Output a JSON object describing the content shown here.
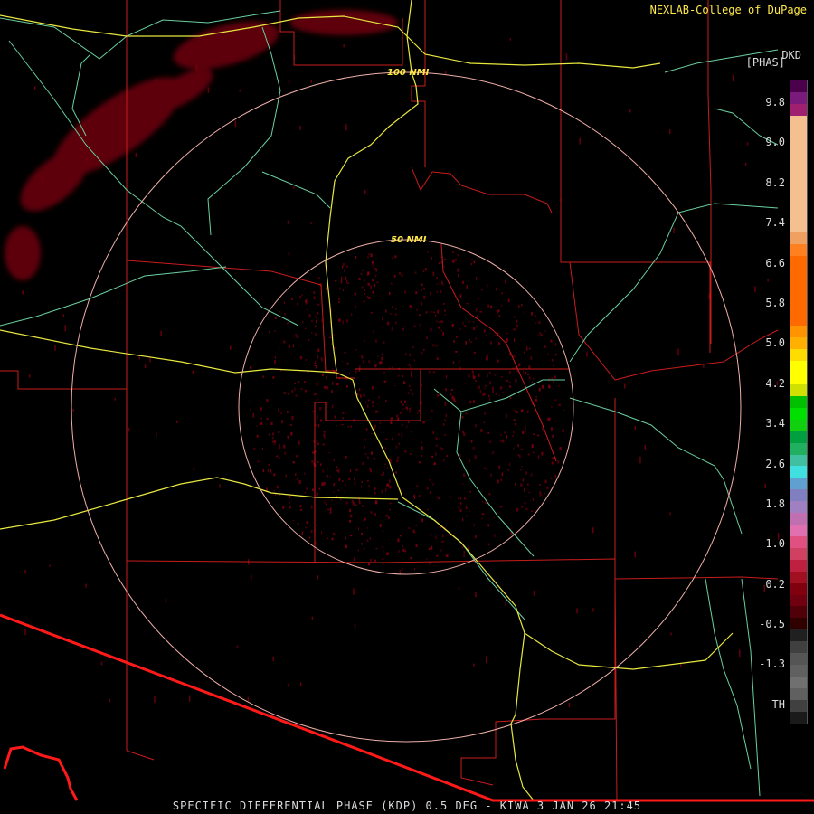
{
  "header": {
    "credit": "NEXLAB-College of DuPage",
    "product_code": "DKD",
    "units": "[PHAS]"
  },
  "footer": {
    "caption": "SPECIFIC DIFFERENTIAL PHASE (KDP) 0.5 DEG - KIWA 3 JAN 26 21:45"
  },
  "range_rings": [
    {
      "label": "50 NMI",
      "range_nmi": 50
    },
    {
      "label": "100 NMI",
      "range_nmi": 100
    }
  ],
  "colorbar": {
    "tick_labels": [
      "9.8",
      "9.0",
      "8.2",
      "7.4",
      "6.6",
      "5.8",
      "5.0",
      "4.2",
      "3.4",
      "2.6",
      "1.8",
      "1.0",
      "0.2",
      "-0.5",
      "-1.3",
      "TH"
    ],
    "colors": [
      "#4a004a",
      "#7a1a7a",
      "#a02070",
      "#f4c090",
      "#f4c090",
      "#f4c090",
      "#f4c090",
      "#f4c090",
      "#f4c090",
      "#f4c090",
      "#f4c090",
      "#f4c090",
      "#f4c090",
      "#f0a060",
      "#ff8020",
      "#ff6a00",
      "#ff6a00",
      "#ff6a00",
      "#ff6a00",
      "#ff6a00",
      "#ff6a00",
      "#ff9400",
      "#ffb000",
      "#ffdc00",
      "#ffff00",
      "#ffff00",
      "#d0e000",
      "#00c000",
      "#00e000",
      "#10d010",
      "#00a040",
      "#20b060",
      "#40c0a0",
      "#40e0e0",
      "#60a0d0",
      "#8080c0",
      "#a080c0",
      "#c070b0",
      "#e070b0",
      "#e05080",
      "#d04060",
      "#c02040",
      "#a01020",
      "#800010",
      "#700010",
      "#500008",
      "#300000",
      "#202020",
      "#404040",
      "#555555",
      "#606060",
      "#707070",
      "#606060",
      "#404040",
      "#1a1a1a"
    ]
  },
  "map_colors": {
    "county_lines": "#c81c1c",
    "highways": "#e8e840",
    "rivers_roads": "#6ad0a0",
    "range_rings": "#f0b0a8",
    "intl_border": "#ff1a1a",
    "radar_echo": "#7a0010"
  }
}
